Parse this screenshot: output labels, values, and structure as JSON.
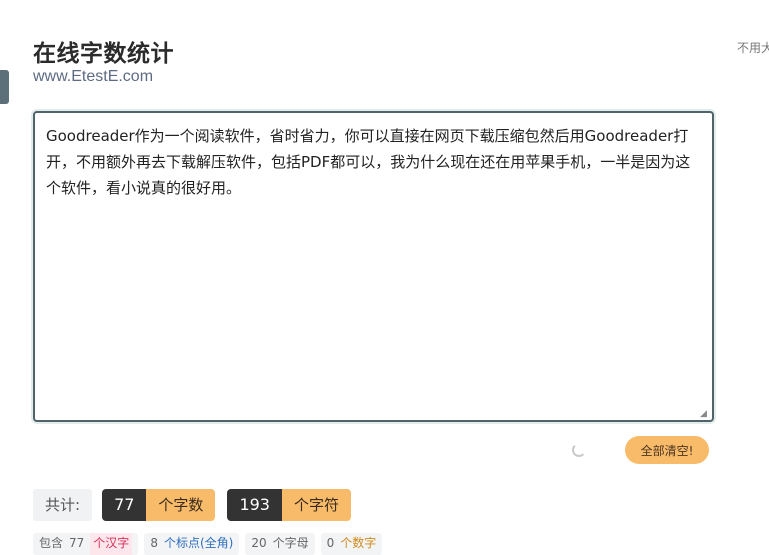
{
  "header": {
    "title": "在线字数统计",
    "subtitle": "www.EtestE.com",
    "corner_note": "不用大"
  },
  "editor": {
    "text": "Goodreader作为一个阅读软件，省时省力，你可以直接在网页下载压缩包然后用Goodreader打开，不用额外再去下载解压软件，包括PDF都可以，我为什么现在还在用苹果手机，一半是因为这个软件，看小说真的很好用。"
  },
  "actions": {
    "clear_label": "全部清空!"
  },
  "stats": {
    "total_label": "共计:",
    "word_count": "77",
    "word_unit": "个字数",
    "char_count": "193",
    "char_unit": "个字符"
  },
  "details": {
    "chip1_prefix": "包含",
    "chip1_num": "77",
    "chip1_unit": "个汉字",
    "chip2_num": "8",
    "chip2_unit": "个标点(全角)",
    "chip3_num": "20",
    "chip3_unit": "个字母",
    "chip4_num": "0",
    "chip4_unit": "个数字"
  }
}
